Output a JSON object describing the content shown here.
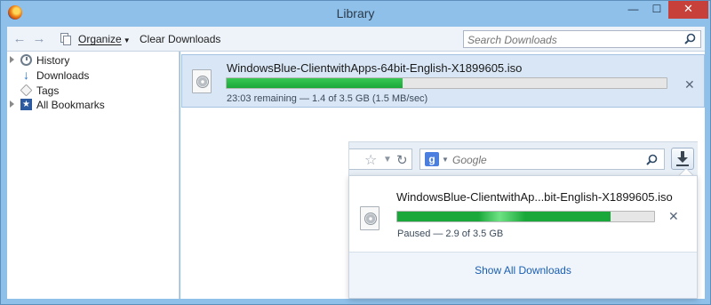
{
  "window": {
    "title": "Library",
    "controls": {
      "minimize": "—",
      "maximize": "☐",
      "close": "✕"
    }
  },
  "toolbar": {
    "organize_label": "Organize",
    "clear_label": "Clear Downloads",
    "search_placeholder": "Search Downloads"
  },
  "sidebar": {
    "items": [
      {
        "label": "History",
        "icon": "history-icon",
        "expandable": true
      },
      {
        "label": "Downloads",
        "icon": "downloads-icon",
        "expandable": false
      },
      {
        "label": "Tags",
        "icon": "tags-icon",
        "expandable": false
      },
      {
        "label": "All Bookmarks",
        "icon": "bookmarks-icon",
        "expandable": true
      }
    ]
  },
  "downloads": [
    {
      "name": "WindowsBlue-ClientwithApps-64bit-English-X1899605.iso",
      "status": "23:03 remaining — 1.4 of 3.5 GB (1.5 MB/sec)",
      "progress": 0.4
    }
  ],
  "browser": {
    "search_placeholder": "Google",
    "search_engine_glyph": "g"
  },
  "panel": {
    "name": "WindowsBlue-ClientwithAp...bit-English-X1899605.iso",
    "status": "Paused —  2.9 of 3.5 GB",
    "progress": 0.83,
    "show_all_label": "Show All Downloads"
  },
  "colors": {
    "progress_fill": "#1aa83a",
    "selected_row": "#d8e6f5",
    "link": "#1b5fb2",
    "close_button": "#c7413a"
  }
}
